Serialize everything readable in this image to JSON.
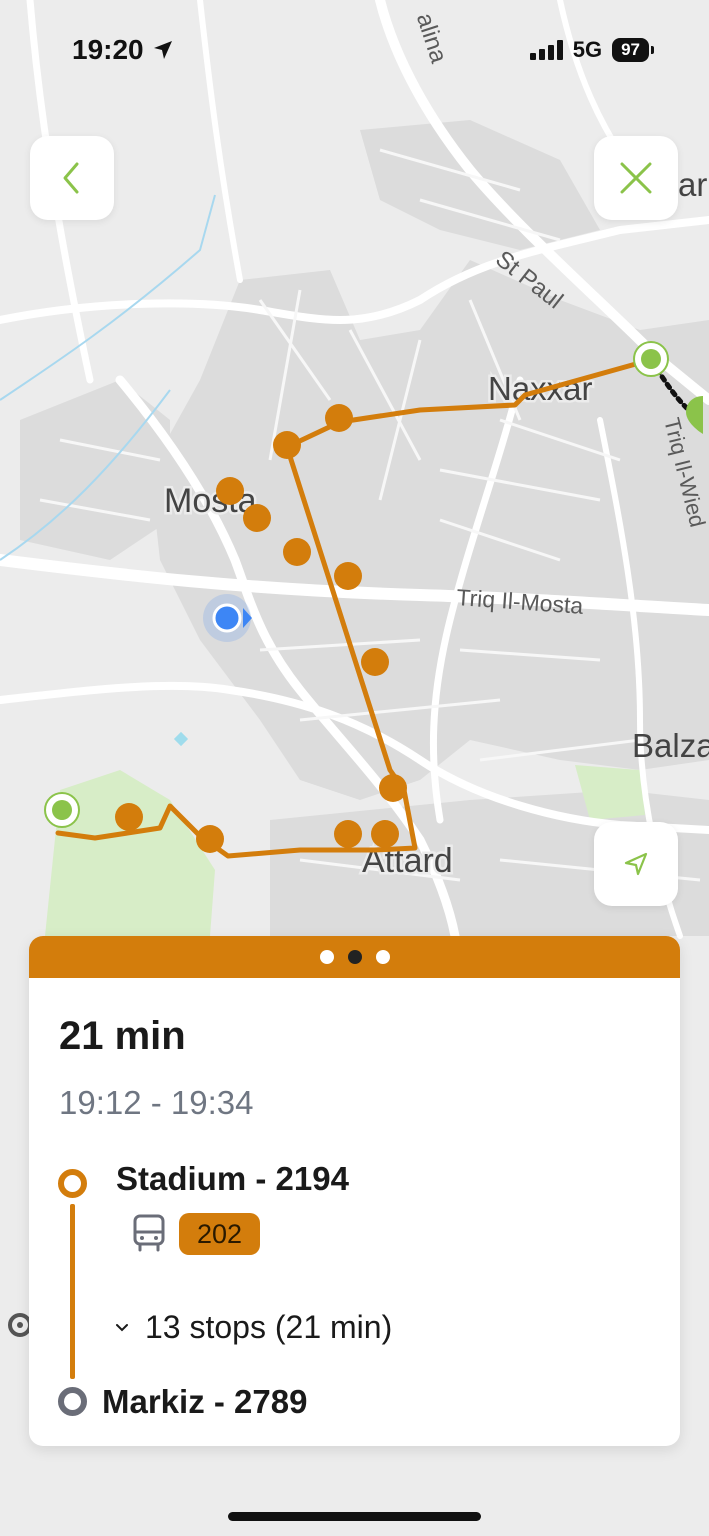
{
  "status_bar": {
    "time": "19:20",
    "network": "5G",
    "battery": "97"
  },
  "map": {
    "labels": {
      "top_road": "alina",
      "st_paul": "St Paul",
      "naxxar": "Naxxar",
      "triq_il_wied": "Triq Il-Wied",
      "mosta": "Mosta",
      "triq_il_mosta": "Triq Il-Mosta",
      "balzan": "Balza",
      "attard": "Attard",
      "edge_right": "ar"
    },
    "route_color": "#d37d0c",
    "endpoint_color": "#8bc34a",
    "user_location_color": "#3d86f5"
  },
  "controls": {
    "back": {
      "icon": "chevron-left-icon",
      "color": "#8bc34a"
    },
    "close": {
      "icon": "close-icon",
      "color": "#8bc34a"
    },
    "locate": {
      "icon": "navigation-arrow-icon",
      "color": "#8bc34a"
    }
  },
  "trip_card": {
    "pager": {
      "count": 3,
      "active": 2
    },
    "duration": "21 min",
    "time_range": "19:12 - 19:34",
    "from_stop": "Stadium - 2194",
    "bus_icon": "bus-icon",
    "route_number": "202",
    "stops_summary": "13 stops (21 min)",
    "to_stop": "Markiz - 2789"
  }
}
